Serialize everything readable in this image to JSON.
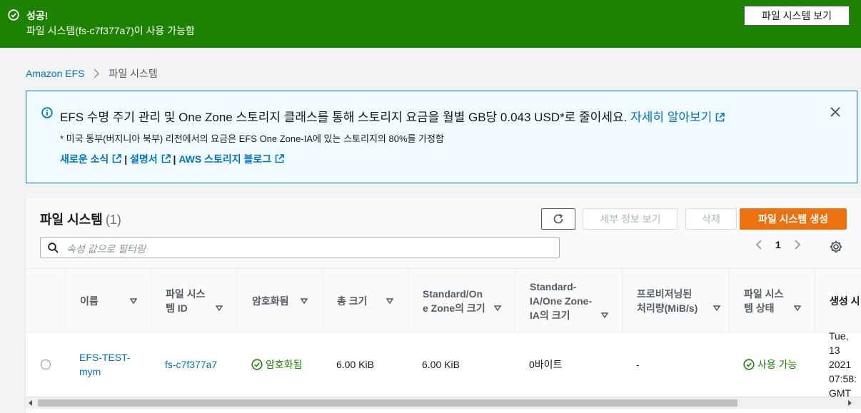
{
  "flash": {
    "title": "성공!",
    "message": "파일 시스템(fs-c7f377a7)이 사용 가능함",
    "button": "파일 시스템 보기",
    "color": "#1d8102"
  },
  "breadcrumb": {
    "root": "Amazon EFS",
    "current": "파일 시스템"
  },
  "info": {
    "headline": "EFS 수명 주기 관리 및 One Zone 스토리지 클래스를 통해 스토리지 요금을 월별 GB당 0.043 USD*로 줄이세요.",
    "learn_more": "자세히 알아보기",
    "note": "* 미국 동부(버지니아 북부) 리전에서의 요금은 EFS One Zone-IA에 있는 스토리지의 80%를 가정함",
    "links": [
      "새로운 소식",
      "설명서",
      "AWS 스토리지 블로그"
    ],
    "separator": "|"
  },
  "panel": {
    "title": "파일 시스템",
    "count": "(1)",
    "buttons": {
      "details": "세부 정보 보기",
      "delete": "삭제",
      "create": "파일 시스템 생성"
    },
    "search_placeholder": "속성 값으로 필터링",
    "page": "1",
    "accent": "#ec7211"
  },
  "table": {
    "columns": [
      {
        "l1": "이름",
        "l2": ""
      },
      {
        "l1": "파일 시스",
        "l2": "템 ID"
      },
      {
        "l1": "암호화됨",
        "l2": ""
      },
      {
        "l1": "총 크기",
        "l2": ""
      },
      {
        "l1": "Standard/On",
        "l2": "e Zone의 크기"
      },
      {
        "l1": "Standard-",
        "l2": "IA/One Zone-",
        "l3": "IA의 크기"
      },
      {
        "l1": "프로비저닝된",
        "l2": "처리량(MiB/s)"
      },
      {
        "l1": "파일 시스",
        "l2": "템 상태"
      },
      {
        "l1": "생성 시",
        "l2": ""
      }
    ],
    "rows": [
      {
        "name_l1": "EFS-TEST-",
        "name_l2": "mym",
        "id": "fs-c7f377a7",
        "encrypted": "암호화됨",
        "total_size": "6.00 KiB",
        "standard_size": "6.00 KiB",
        "ia_size": "0바이트",
        "throughput": "-",
        "state": "사용 가능",
        "created_l1": "Tue, 13",
        "created_l2": "2021",
        "created_l3": "07:58:",
        "created_l4": "GMT"
      }
    ]
  }
}
